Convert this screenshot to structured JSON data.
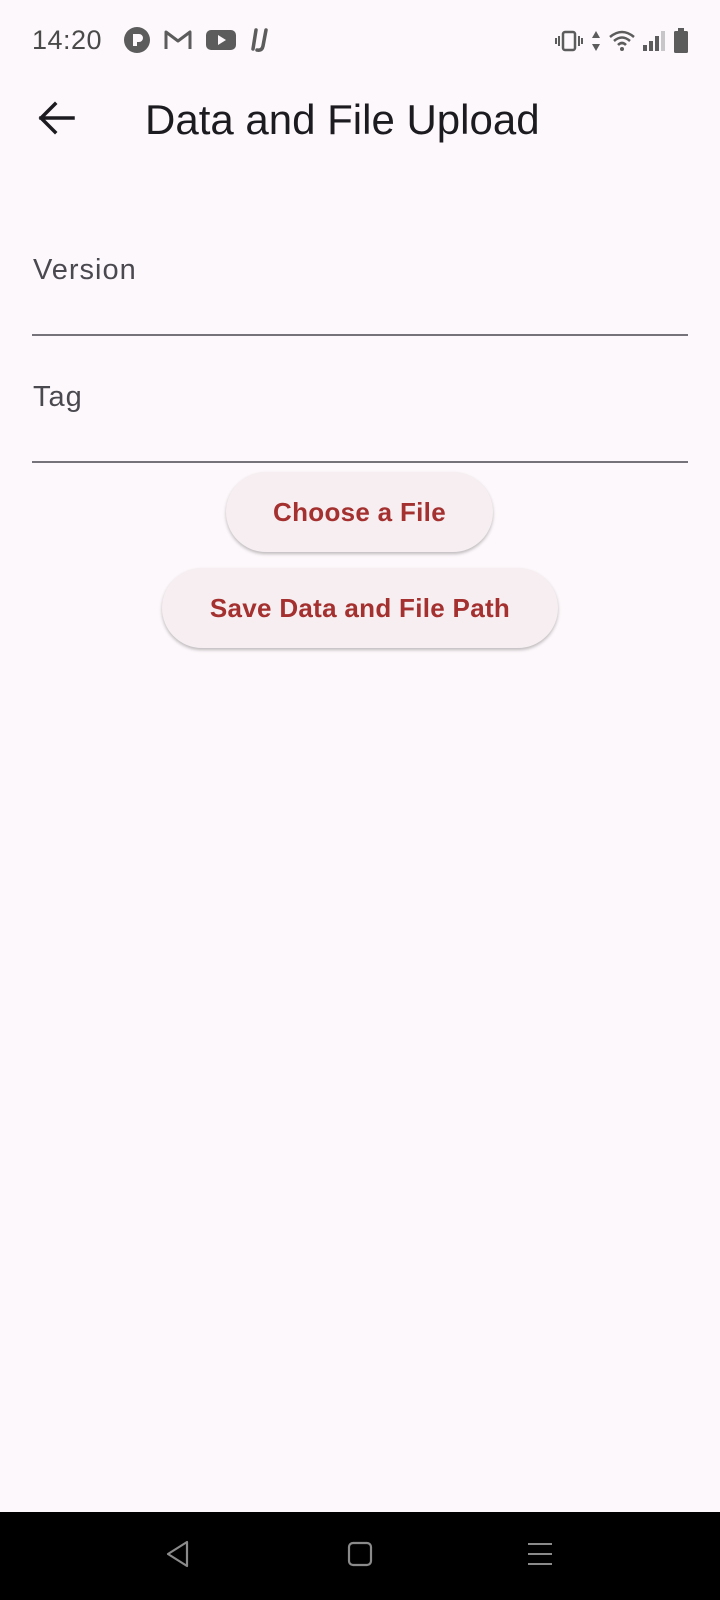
{
  "status_bar": {
    "time": "14:20",
    "notification_icons": [
      "pocket-casts-icon",
      "gmail-icon",
      "youtube-icon",
      "intellij-icon"
    ],
    "system_icons": [
      "vibrate-icon",
      "data-arrows-icon",
      "wifi-icon",
      "signal-icon",
      "battery-icon"
    ]
  },
  "app_bar": {
    "back_icon": "arrow-back-icon",
    "title": "Data and File Upload"
  },
  "form": {
    "version_label": "Version",
    "version_value": "",
    "tag_label": "Tag",
    "tag_value": ""
  },
  "actions": {
    "choose_file_label": "Choose a File",
    "save_label": "Save Data and File Path"
  },
  "nav_bar": {
    "items": [
      "back-triangle-icon",
      "home-square-icon",
      "menu-lines-icon"
    ]
  },
  "colors": {
    "background": "#fdf8fb",
    "button_bg": "#f6eef1",
    "button_text": "#a4312f",
    "title_text": "#1c1b1f",
    "underline": "#76737a"
  }
}
